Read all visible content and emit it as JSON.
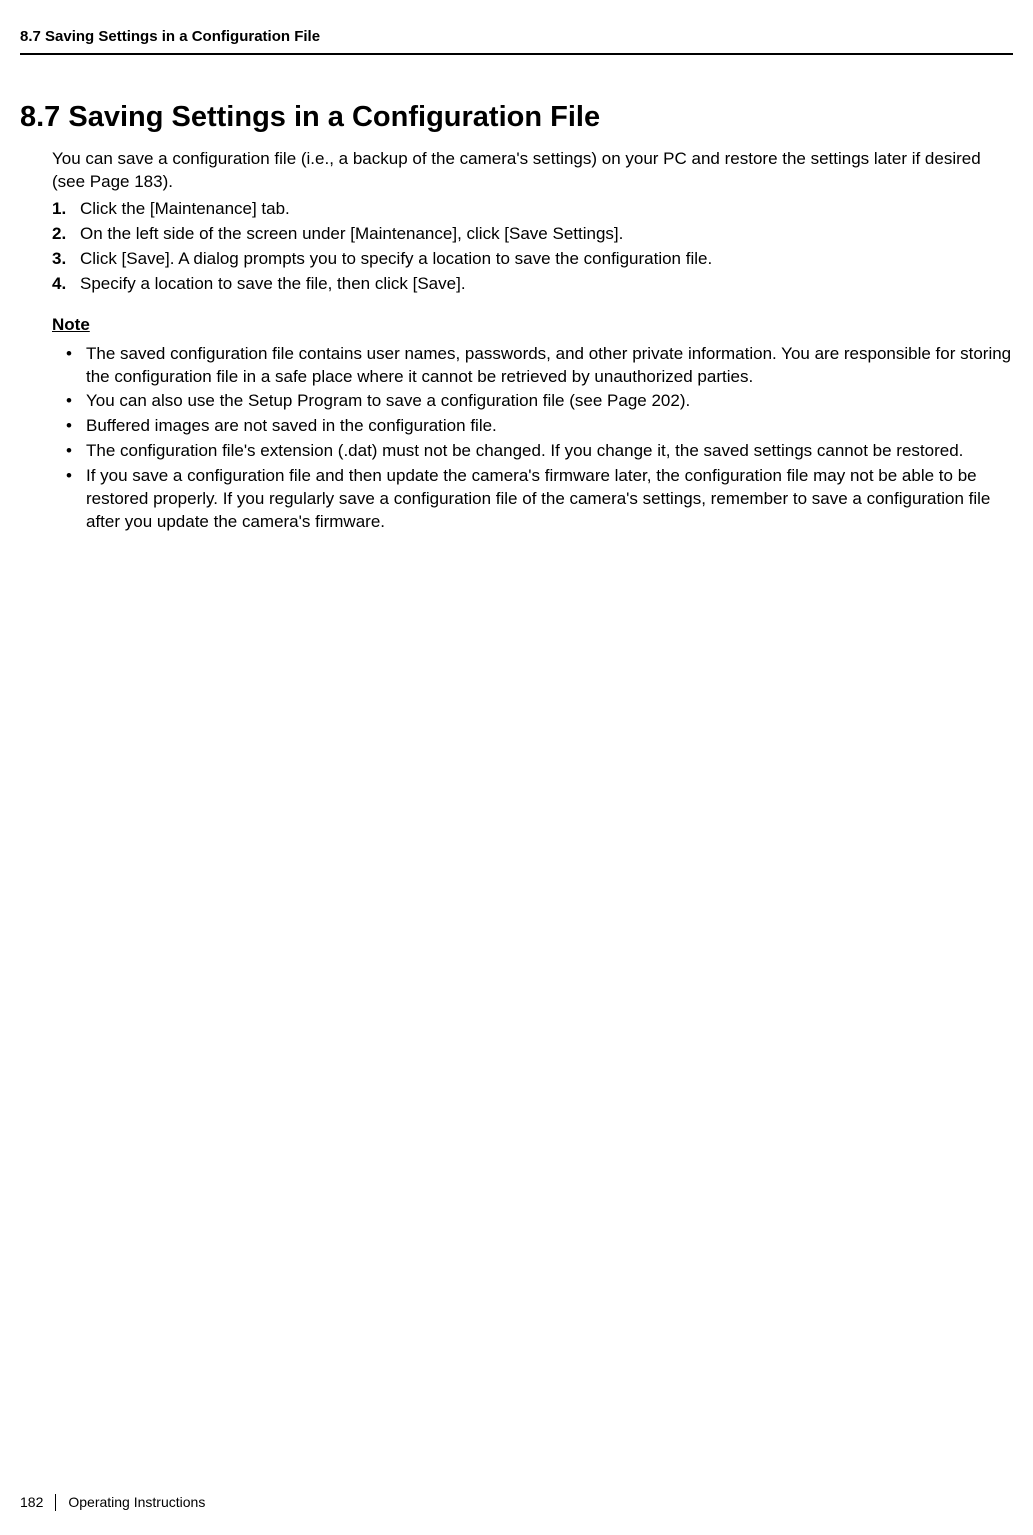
{
  "header": {
    "running_title": "8.7 Saving Settings in a Configuration File"
  },
  "section": {
    "number_title": "8.7  Saving Settings in a Configuration File",
    "intro": "You can save a configuration file (i.e., a backup of the camera's settings) on your PC and restore the settings later if desired (see Page 183).",
    "steps": [
      "Click the [Maintenance] tab.",
      "On the left side of the screen under [Maintenance], click [Save Settings].",
      "Click [Save]. A dialog prompts you to specify a location to save the configuration file.",
      "Specify a location to save the file, then click [Save]."
    ],
    "note_label": "Note",
    "notes": [
      "The saved configuration file contains user names, passwords, and other private information. You are responsible for storing the configuration file in a safe place where it cannot be retrieved by unauthorized parties.",
      "You can also use the Setup Program to save a configuration file (see Page 202).",
      "Buffered images are not saved in the configuration file.",
      "The configuration file's extension (.dat) must not be changed. If you change it, the saved settings cannot be restored.",
      "If you save a configuration file and then update the camera's firmware later, the configuration file may not be able to be restored properly. If you regularly save a configuration file of the camera's settings, remember to save a configuration file after you update the camera's firmware."
    ]
  },
  "footer": {
    "page_number": "182",
    "doc_title": "Operating Instructions"
  }
}
